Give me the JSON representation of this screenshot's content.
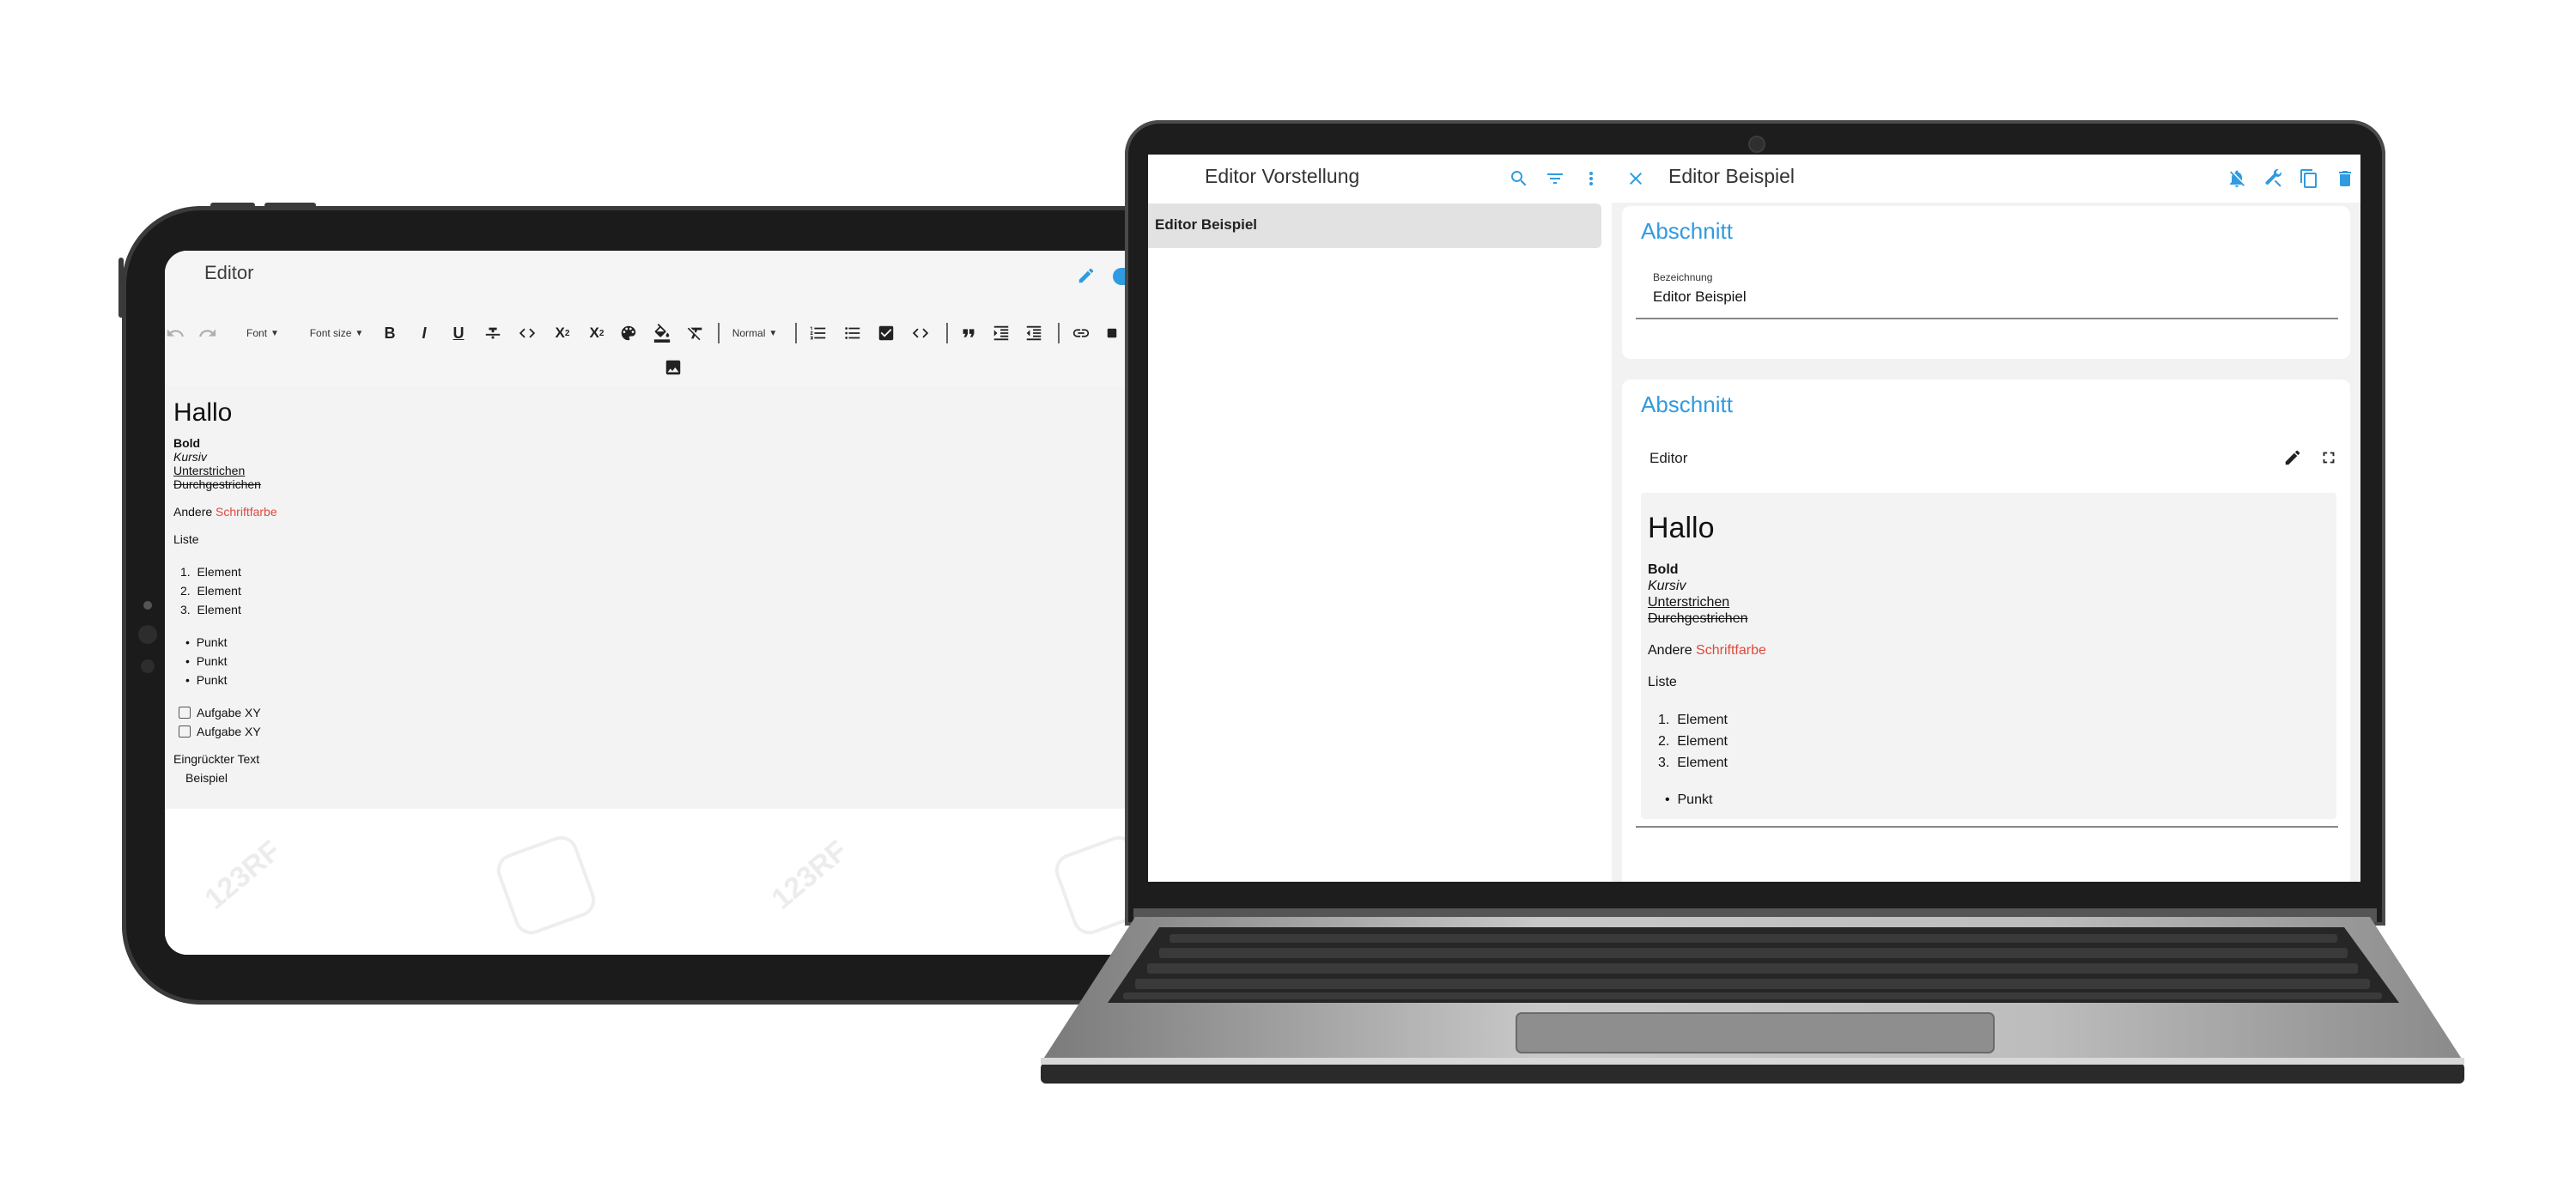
{
  "tablet": {
    "title": "Editor",
    "toolbar": {
      "font": "Font",
      "font_size": "Font size",
      "heading": "Normal",
      "bold": "B",
      "italic": "I",
      "underline": "U"
    },
    "editor": {
      "heading": "Hallo",
      "bold": "Bold",
      "italic": "Kursiv",
      "underline": "Unterstrichen",
      "strike": "Durchgestrichen",
      "color_prefix": "Andere",
      "color_word": "Schriftfarbe",
      "list_label": "Liste",
      "ordered": [
        "Element",
        "Element",
        "Element"
      ],
      "bullets": [
        "Punkt",
        "Punkt",
        "Punkt"
      ],
      "tasks": [
        "Aufgabe XY",
        "Aufgabe XY"
      ],
      "indent_label": "Eingrückter Text",
      "indent_value": "Beispiel"
    },
    "watermark": "123RF"
  },
  "laptop": {
    "left": {
      "title": "Editor Vorstellung",
      "selected_item": "Editor Beispiel"
    },
    "right": {
      "title": "Editor Beispiel",
      "card1": {
        "heading": "Abschnitt",
        "field_label": "Bezeichnung",
        "field_value": "Editor Beispiel"
      },
      "card2": {
        "heading": "Abschnitt",
        "editor_label": "Editor",
        "content": {
          "heading": "Hallo",
          "bold": "Bold",
          "italic": "Kursiv",
          "underline": "Unterstrichen",
          "strike": "Durchgestrichen",
          "color_prefix": "Andere",
          "color_word": "Schriftfarbe",
          "list_label": "Liste",
          "ordered": [
            "Element",
            "Element",
            "Element"
          ],
          "bullets": [
            "Punkt"
          ]
        }
      }
    }
  },
  "colors": {
    "accent": "#2f9be0",
    "red_text": "#e0493c",
    "editor_bg": "#f3f3f3"
  }
}
